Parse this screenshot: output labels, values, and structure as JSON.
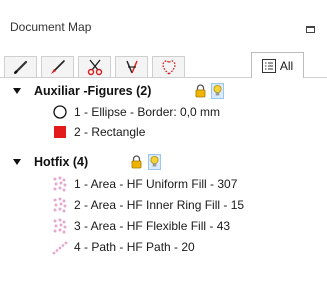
{
  "panel": {
    "title": "Document Map"
  },
  "tabs": [
    {
      "icon": "pencil-icon"
    },
    {
      "icon": "brush-icon"
    },
    {
      "icon": "scissors-icon"
    },
    {
      "icon": "cut-path-icon"
    },
    {
      "icon": "shape-outline-icon"
    },
    {
      "icon": "list-icon",
      "label": "All"
    }
  ],
  "tree": {
    "groups": [
      {
        "label": "Auxiliar -Figures (2)",
        "items": [
          {
            "label": "1 - Ellipse - Border: 0,0 mm",
            "icon": "ellipse-icon"
          },
          {
            "label": "2 - Rectangle",
            "icon": "rectangle-icon"
          }
        ]
      },
      {
        "label": "Hotfix (4)",
        "items": [
          {
            "label": "1 - Area - HF Uniform Fill - 307",
            "icon": "hotfix-area-icon"
          },
          {
            "label": "2 - Area - HF Inner Ring Fill - 15",
            "icon": "hotfix-area-icon"
          },
          {
            "label": "3 - Area - HF Flexible Fill - 43",
            "icon": "hotfix-area-icon"
          },
          {
            "label": "4 - Path - HF Path - 20",
            "icon": "hotfix-path-icon"
          }
        ]
      }
    ]
  },
  "colors": {
    "rectangle": "#e41b1b",
    "hotfix_dots": "#e8a7cf",
    "lock": "#f0b400",
    "bulb": "#f4d33a"
  }
}
